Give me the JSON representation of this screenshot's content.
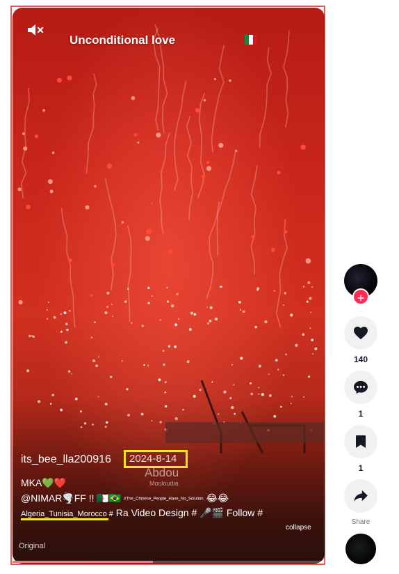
{
  "video": {
    "title": "Unconditional love",
    "mute_icon": "speaker-muted-icon",
    "flag_colors": [
      "#0b8a3c",
      "#ffffff",
      "#d31a24"
    ],
    "author": "its_bee_lla200916",
    "date": "2024-8-14",
    "watermark": "Abdou",
    "watermark_sub": "Mouloudia",
    "description": {
      "line1": "MKA💚❤️",
      "line2_main": "@NIMAR🌪️FF !! 🇩🇿🇧🇷",
      "line2_small": "#The_Chinese_People_Have_No_Solution",
      "line2_end": "😂😂",
      "line3_tag": "Algeria_Tunisia_Morocco #",
      "line3_rest": "Ra Video Design # 🎤🎬 Follow #"
    },
    "collapse_label": "collapse",
    "original_label": "Original",
    "progress_fraction": 0.45
  },
  "rail": {
    "like_count": "140",
    "comment_count": "1",
    "favorite_count": "1",
    "share_label": "Share",
    "accent": "#fe2c55"
  }
}
